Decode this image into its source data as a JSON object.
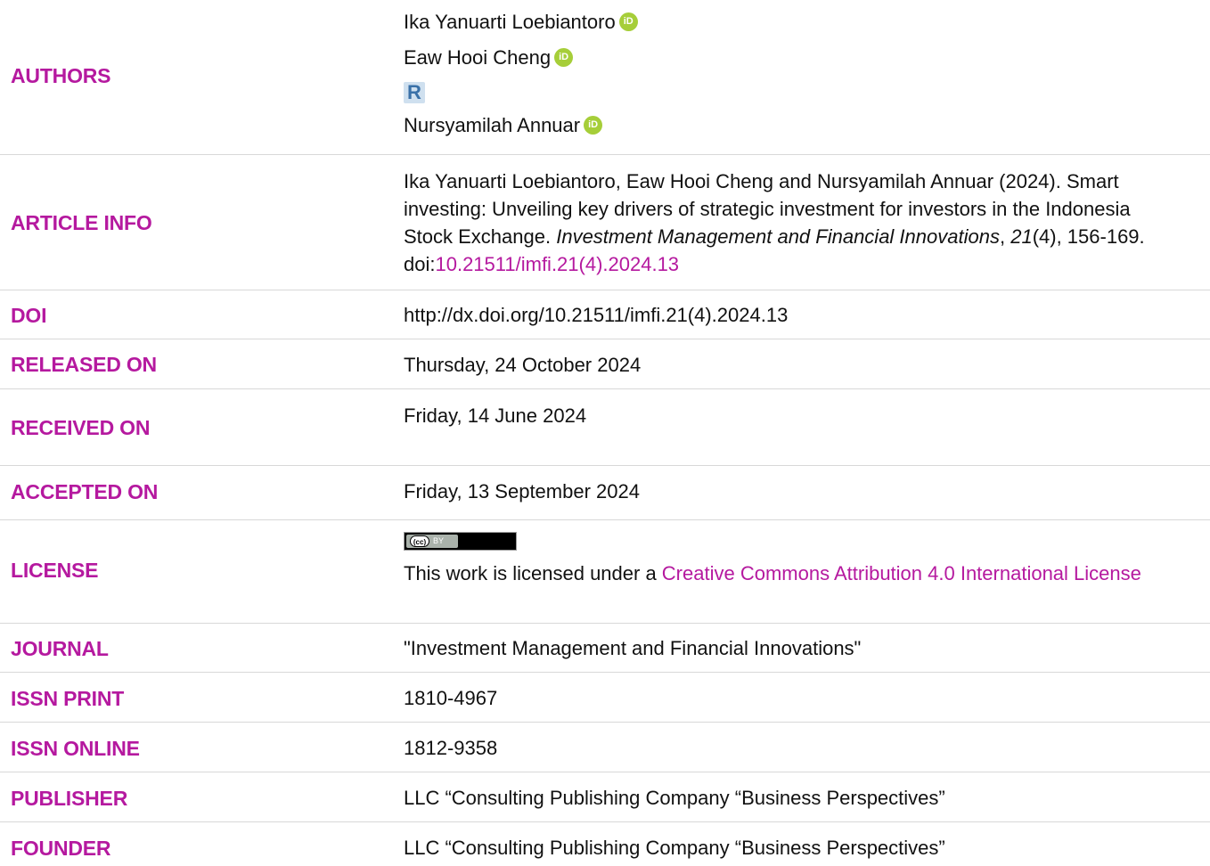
{
  "colors": {
    "accent": "#b5199f",
    "orcid": "#a6ce39"
  },
  "rows": {
    "authors": {
      "label": "AUTHORS",
      "authors": [
        {
          "name": "Ika Yanuarti Loebiantoro",
          "icon": "orcid-icon"
        },
        {
          "name": "Eaw Hooi Cheng",
          "icon": "orcid-icon"
        },
        {
          "name": "Nursyamilah Annuar",
          "icon": "orcid-icon"
        }
      ],
      "researcherid_glyph": "R",
      "orcid_glyph": "iD"
    },
    "article_info": {
      "label": "ARTICLE INFO",
      "citation_text": "Ika Yanuarti Loebiantoro, Eaw Hooi Cheng and Nursyamilah Annuar (2024). Smart investing: Unveiling key drivers of strategic investment for investors in the Indonesia Stock Exchange. ",
      "journal_italic": "Investment Management and Financial Innovations",
      "comma": ", ",
      "volume_italic": "21",
      "issue_pages": "(4), 156-169. doi:",
      "doi_link": "10.21511/imfi.21(4).2024.13"
    },
    "doi": {
      "label": "DOI",
      "value": "http://dx.doi.org/10.21511/imfi.21(4).2024.13"
    },
    "released_on": {
      "label": "RELEASED ON",
      "value": "Thursday, 24 October 2024"
    },
    "received_on": {
      "label": "RECEIVED ON",
      "value": "Friday, 14 June 2024"
    },
    "accepted_on": {
      "label": "ACCEPTED ON",
      "value": "Friday, 13 September 2024"
    },
    "license": {
      "label": "LICENSE",
      "badge_cc": "(cc)",
      "badge_by": "BY",
      "text": "This work is licensed under a ",
      "link": "Creative Commons Attribution 4.0 International License"
    },
    "journal": {
      "label": "JOURNAL",
      "value": "\"Investment Management and Financial Innovations\""
    },
    "issn_print": {
      "label": "ISSN PRINT",
      "value": "1810-4967"
    },
    "issn_online": {
      "label": "ISSN ONLINE",
      "value": "1812-9358"
    },
    "publisher": {
      "label": "PUBLISHER",
      "value": "LLC “Consulting Publishing Company “Business Perspectives”"
    },
    "founder": {
      "label": "FOUNDER",
      "value": "LLC “Consulting Publishing Company “Business Perspectives”"
    }
  }
}
